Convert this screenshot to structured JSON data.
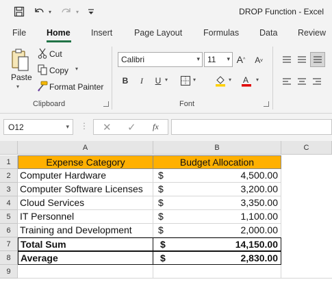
{
  "titlebar": {
    "title": "DROP Function  -  Excel",
    "icons": [
      "save-icon",
      "undo-icon",
      "redo-icon",
      "customize-qat-icon"
    ]
  },
  "tabs": [
    "File",
    "Home",
    "Insert",
    "Page Layout",
    "Formulas",
    "Data",
    "Review"
  ],
  "active_tab": "Home",
  "ribbon": {
    "clipboard": {
      "paste": "Paste",
      "cut": "Cut",
      "copy": "Copy",
      "format_painter": "Format Painter",
      "label": "Clipboard"
    },
    "font": {
      "font_name": "Calibri",
      "font_size": "11",
      "bold": "B",
      "italic": "I",
      "underline": "U",
      "label": "Font"
    },
    "accent_color": "#217346",
    "fill_color": "#ffd000",
    "font_color": "#e00000"
  },
  "formula_bar": {
    "name_box": "O12",
    "fx": "fx",
    "formula": ""
  },
  "sheet": {
    "columns": [
      "A",
      "B",
      "C"
    ],
    "rows": [
      "1",
      "2",
      "3",
      "4",
      "5",
      "6",
      "7",
      "8",
      "9"
    ],
    "header": [
      "Expense Category",
      "Budget Allocation"
    ],
    "header_fill": "#ffb000",
    "data": [
      {
        "category": "Computer Hardware",
        "currency": "$",
        "amount": "4,500.00"
      },
      {
        "category": "Computer Software Licenses",
        "currency": "$",
        "amount": "3,200.00"
      },
      {
        "category": "Cloud Services",
        "currency": "$",
        "amount": "3,350.00"
      },
      {
        "category": "IT Personnel",
        "currency": "$",
        "amount": "1,100.00"
      },
      {
        "category": "Training and Development",
        "currency": "$",
        "amount": "2,000.00"
      }
    ],
    "totals": [
      {
        "label": "Total Sum",
        "currency": "$",
        "amount": "14,150.00"
      },
      {
        "label": "Average",
        "currency": "$",
        "amount": "2,830.00"
      }
    ]
  }
}
